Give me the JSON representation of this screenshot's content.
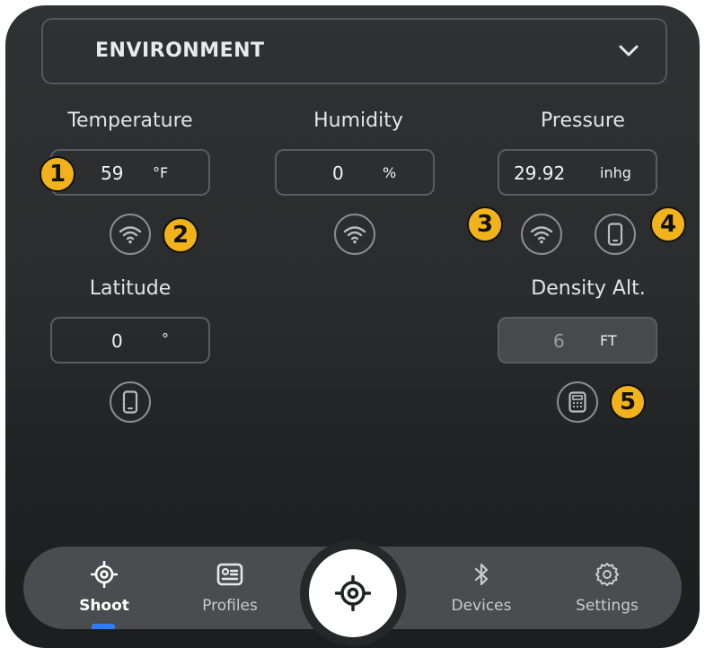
{
  "section_select": {
    "label": "ENVIRONMENT",
    "icon": "chevron-down-icon"
  },
  "temperature": {
    "label": "Temperature",
    "value": "59",
    "unit": "°F",
    "source_icon": "wifi-icon"
  },
  "humidity": {
    "label": "Humidity",
    "value": "0",
    "unit": "%",
    "source_icon": "wifi-icon"
  },
  "pressure": {
    "label": "Pressure",
    "value": "29.92",
    "unit": "inhg",
    "source_icons": [
      "wifi-icon",
      "phone-icon"
    ]
  },
  "latitude": {
    "label": "Latitude",
    "value": "0",
    "unit": "°",
    "source_icon": "phone-icon"
  },
  "density_alt": {
    "label": "Density Alt.",
    "value": "6",
    "unit": "FT",
    "source_icon": "calculator-icon"
  },
  "callouts": [
    "1",
    "2",
    "3",
    "4",
    "5"
  ],
  "nav": {
    "items": [
      {
        "label": "Shoot",
        "icon": "crosshair-icon",
        "active": true
      },
      {
        "label": "Profiles",
        "icon": "profile-card-icon"
      },
      {
        "label": "Devices",
        "icon": "bluetooth-icon"
      },
      {
        "label": "Settings",
        "icon": "gear-icon"
      }
    ],
    "center_icon": "crosshair-icon"
  },
  "colors": {
    "accent": "#2f7df6",
    "callout": "#f2b21a",
    "background": "#2c2e2f"
  }
}
